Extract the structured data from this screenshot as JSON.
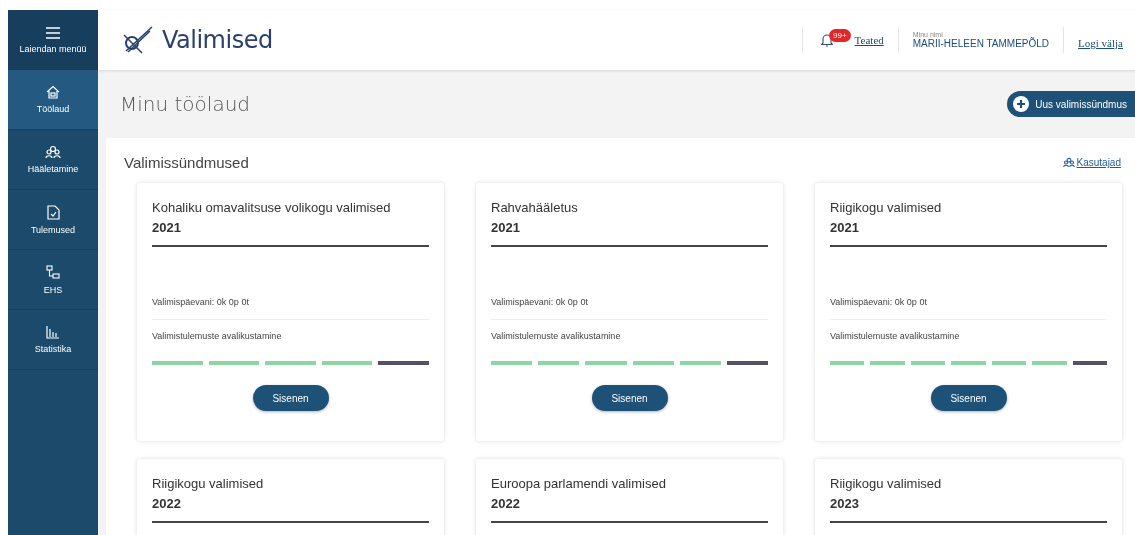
{
  "sidebar": {
    "menu_label": "Laiendan menüü",
    "items": [
      {
        "label": "Töölaud",
        "selected": true
      },
      {
        "label": "Hääletamine",
        "selected": false
      },
      {
        "label": "Tulemused",
        "selected": false
      },
      {
        "label": "EHS",
        "selected": false
      },
      {
        "label": "Statistika",
        "selected": false
      }
    ]
  },
  "header": {
    "logo": "Valimised",
    "badge": "99+",
    "notifications": "Teated",
    "user_caption": "Minu nimi",
    "user_name": "MARII-HELEEN TAMMEPÕLD",
    "logout": "Logi välja"
  },
  "page": {
    "title": "Minu töölaud",
    "new_button": "Uus valimissündmus"
  },
  "panel": {
    "title": "Valimissündmused",
    "users_link": "Kasutajad",
    "cards": [
      {
        "title": "Kohaliku omavalitsuse volikogu valimised",
        "year": "2021",
        "countdown": "Valimispäevani: 0k 0p 0t",
        "phase": "Valimistulemuste avalikustamine",
        "steps": [
          {
            "done": true
          },
          {
            "done": true
          },
          {
            "done": true
          },
          {
            "done": true
          },
          {
            "done": false
          }
        ],
        "button": "Sisenen"
      },
      {
        "title": "Rahvahääletus",
        "year": "2021",
        "countdown": "Valimispäevani: 0k 0p 0t",
        "phase": "Valimistulemuste avalikustamine",
        "steps": [
          {
            "done": true
          },
          {
            "done": true
          },
          {
            "done": true
          },
          {
            "done": true
          },
          {
            "done": true
          },
          {
            "done": false
          }
        ],
        "button": "Sisenen"
      },
      {
        "title": "Riigikogu valimised",
        "year": "2021",
        "countdown": "Valimispäevani: 0k 0p 0t",
        "phase": "Valimistulemuste avalikustamine",
        "steps": [
          {
            "done": true
          },
          {
            "done": true
          },
          {
            "done": true
          },
          {
            "done": true
          },
          {
            "done": true
          },
          {
            "done": true
          },
          {
            "done": false
          }
        ],
        "button": "Sisenen"
      },
      {
        "title": "Riigikogu valimised",
        "year": "2022"
      },
      {
        "title": "Euroopa parlamendi valimised",
        "year": "2022"
      },
      {
        "title": "Riigikogu valimised",
        "year": "2023"
      }
    ]
  }
}
